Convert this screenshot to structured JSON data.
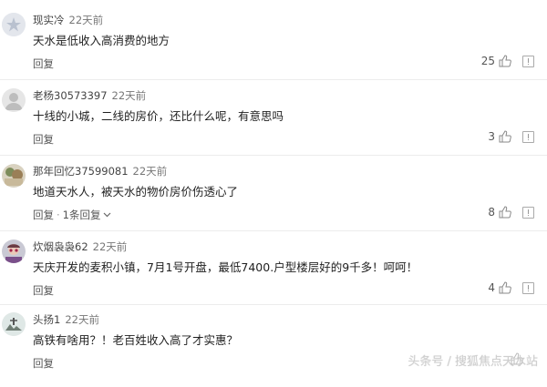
{
  "comments": [
    {
      "user": "现实冷",
      "time": "22天前",
      "text": "天水是低收入高消费的地方",
      "reply": "回复",
      "likes": "25"
    },
    {
      "user": "老杨30573397",
      "time": "22天前",
      "text": "十线的小城，二线的房价，还比什么呢，有意思吗",
      "reply": "回复",
      "likes": "3"
    },
    {
      "user": "那年回忆37599081",
      "time": "22天前",
      "text": "地道天水人，被天水的物价房价伤透心了",
      "reply": "回复",
      "reply_count": "1条回复",
      "likes": "8"
    },
    {
      "user": "炊烟袅袅62",
      "time": "22天前",
      "text": "天庆开发的麦积小镇，7月1号开盘，最低7400.户型楼层好的9千多！呵呵！",
      "reply": "回复",
      "likes": "4"
    },
    {
      "user": "头扬1",
      "time": "22天前",
      "text": "高铁有啥用？！老百姓收入高了才实惠？",
      "reply": "回复"
    }
  ],
  "watermark": "头条号 / 搜狐焦点天水站",
  "colors": {
    "text": "#1f1f1f",
    "meta": "#666666",
    "divider": "#ececec"
  }
}
